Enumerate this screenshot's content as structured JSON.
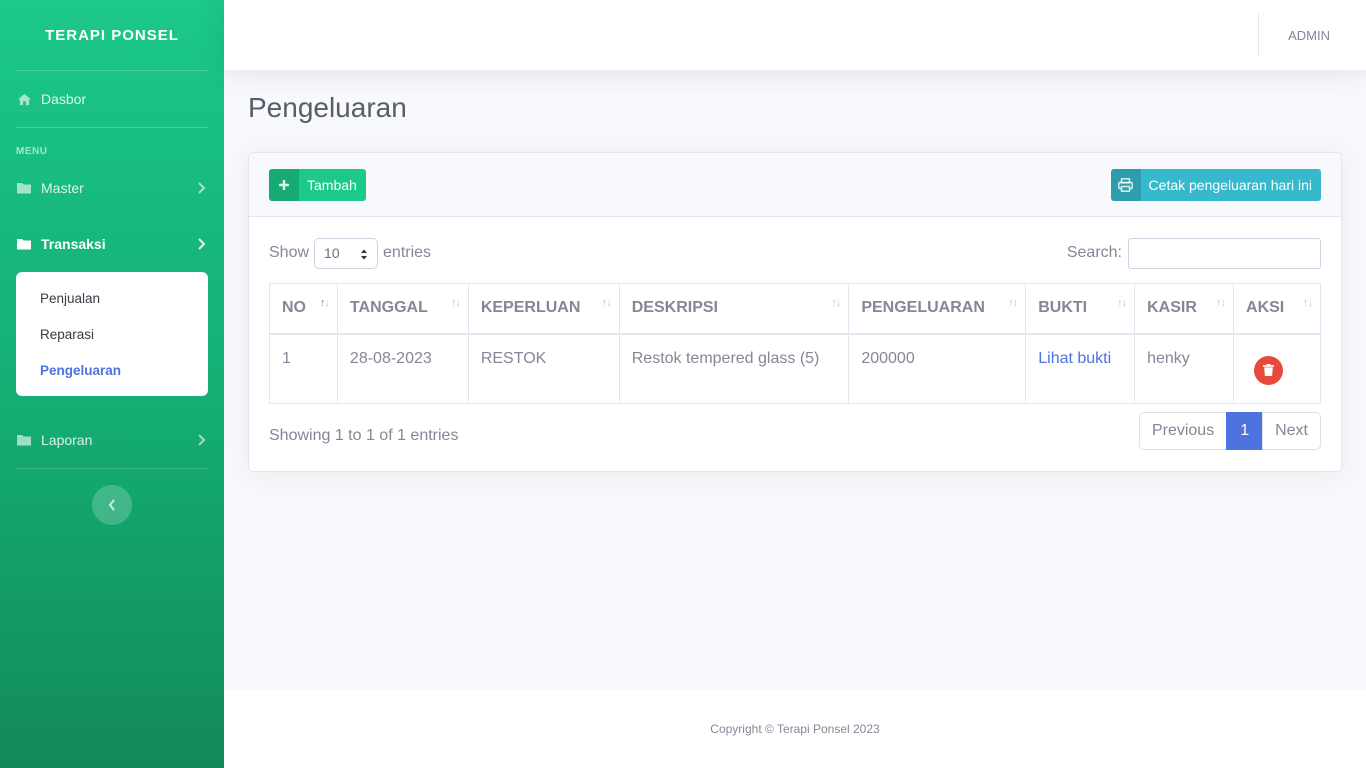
{
  "sidebar": {
    "brand": "TERAPI PONSEL",
    "dashboard": "Dasbor",
    "heading_menu": "MENU",
    "master": "Master",
    "transaksi": "Transaksi",
    "transaksi_items": [
      "Penjualan",
      "Reparasi",
      "Pengeluaran"
    ],
    "laporan": "Laporan"
  },
  "topbar": {
    "user": "ADMIN"
  },
  "page": {
    "title": "Pengeluaran"
  },
  "toolbar": {
    "add_label": "Tambah",
    "print_label": "Cetak pengeluaran hari ini"
  },
  "table_controls": {
    "show": "Show",
    "length_value": "10",
    "entries": "entries",
    "search_label": "Search:",
    "search_value": ""
  },
  "table": {
    "columns": [
      "NO",
      "TANGGAL",
      "KEPERLUAN",
      "DESKRIPSI",
      "PENGELUARAN",
      "BUKTI",
      "KASIR",
      "AKSI"
    ],
    "rows": [
      {
        "no": "1",
        "tanggal": "28-08-2023",
        "keperluan": "RESTOK",
        "deskripsi": "Restok tempered glass (5)",
        "pengeluaran": "200000",
        "bukti": "Lihat bukti",
        "kasir": "henky"
      }
    ]
  },
  "pagination": {
    "info": "Showing 1 to 1 of 1 entries",
    "previous": "Previous",
    "current": "1",
    "next": "Next"
  },
  "footer": {
    "copyright": "Copyright © Terapi Ponsel 2023"
  },
  "colors": {
    "sidebar": "#1cc88a",
    "primary": "#4e73df",
    "success": "#1cc88a",
    "info": "#36b9cc",
    "danger": "#e74a3b"
  },
  "icons": {
    "dashboard": "home-icon",
    "folder": "folder-icon",
    "chevron": "chevron-right-icon",
    "add": "plus-icon",
    "print": "print-icon",
    "delete": "trash-icon",
    "toggle": "chevron-left-icon"
  }
}
